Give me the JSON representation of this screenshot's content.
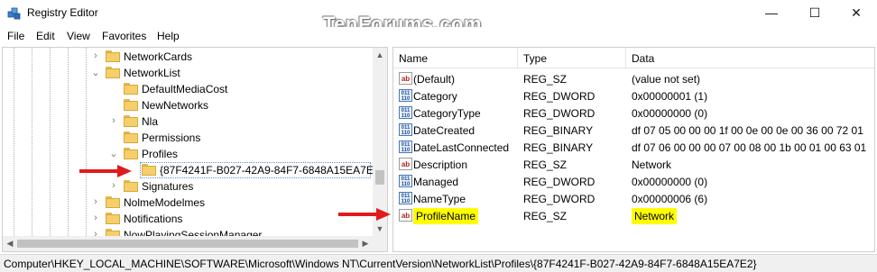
{
  "window": {
    "title": "Registry Editor",
    "watermark": "TenForums.com",
    "controls": {
      "minimize": "—",
      "maximize": "☐",
      "close": "✕"
    }
  },
  "menu": [
    "File",
    "Edit",
    "View",
    "Favorites",
    "Help"
  ],
  "tree": {
    "items": [
      {
        "label": "NetworkCards",
        "expander": "collapsed"
      },
      {
        "label": "NetworkList",
        "expander": "expanded"
      },
      {
        "label": "DefaultMediaCost",
        "expander": "none"
      },
      {
        "label": "NewNetworks",
        "expander": "none"
      },
      {
        "label": "Nla",
        "expander": "collapsed"
      },
      {
        "label": "Permissions",
        "expander": "none"
      },
      {
        "label": "Profiles",
        "expander": "expanded"
      },
      {
        "label": "{87F4241F-B027-42A9-84F7-6848A15EA7E2}",
        "expander": "none",
        "selected": true
      },
      {
        "label": "Signatures",
        "expander": "collapsed"
      },
      {
        "label": "NolmeModelmes",
        "expander": "collapsed"
      },
      {
        "label": "Notifications",
        "expander": "collapsed"
      },
      {
        "label": "NowPlayingSessionManager",
        "expander": "collapsed"
      }
    ]
  },
  "values": {
    "columns": {
      "name": "Name",
      "type": "Type",
      "data": "Data"
    },
    "rows": [
      {
        "icon": "string-value-icon",
        "name": "(Default)",
        "type": "REG_SZ",
        "data": "(value not set)"
      },
      {
        "icon": "binary-value-icon",
        "name": "Category",
        "type": "REG_DWORD",
        "data": "0x00000001 (1)"
      },
      {
        "icon": "binary-value-icon",
        "name": "CategoryType",
        "type": "REG_DWORD",
        "data": "0x00000000 (0)"
      },
      {
        "icon": "binary-value-icon",
        "name": "DateCreated",
        "type": "REG_BINARY",
        "data": "df 07 05 00 00 00 1f 00 0e 00 0e 00 36 00 72 01"
      },
      {
        "icon": "binary-value-icon",
        "name": "DateLastConnected",
        "type": "REG_BINARY",
        "data": "df 07 06 00 00 00 07 00 08 00 1b 00 01 00 63 01"
      },
      {
        "icon": "string-value-icon",
        "name": "Description",
        "type": "REG_SZ",
        "data": "Network"
      },
      {
        "icon": "binary-value-icon",
        "name": "Managed",
        "type": "REG_DWORD",
        "data": "0x00000000 (0)"
      },
      {
        "icon": "binary-value-icon",
        "name": "NameType",
        "type": "REG_DWORD",
        "data": "0x00000006 (6)"
      },
      {
        "icon": "string-value-icon",
        "name": "ProfileName",
        "type": "REG_SZ",
        "data": "Network",
        "highlighted": true
      }
    ]
  },
  "icon_glyphs": {
    "string": "ab",
    "binary": "011\n110"
  },
  "colors": {
    "highlight": "#ffff00",
    "arrow": "#e01b1b",
    "selection_border": "#5a8fd0"
  },
  "status": {
    "path": "Computer\\HKEY_LOCAL_MACHINE\\SOFTWARE\\Microsoft\\Windows NT\\CurrentVersion\\NetworkList\\Profiles\\{87F4241F-B027-42A9-84F7-6848A15EA7E2}"
  }
}
